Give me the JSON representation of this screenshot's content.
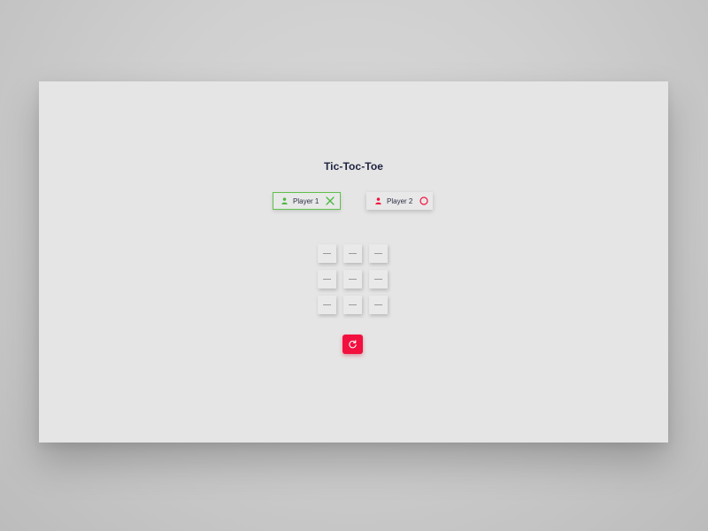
{
  "title": "Tic-Toc-Toe",
  "players": [
    {
      "label": "Player 1",
      "mark": "x-icon",
      "active": true,
      "color": "#4cb840"
    },
    {
      "label": "Player 2",
      "mark": "o-icon",
      "active": false,
      "color": "#f2103e"
    }
  ],
  "board": [
    "",
    "",
    "",
    "",
    "",
    "",
    "",
    "",
    ""
  ],
  "empty_cell_symbol": "dash",
  "reset": {
    "icon": "refresh-icon",
    "color": "#f2103e"
  },
  "colors": {
    "background": "#e5e5e5",
    "title": "#1f2340",
    "player1_accent": "#4cb840",
    "player2_accent": "#f2103e"
  }
}
